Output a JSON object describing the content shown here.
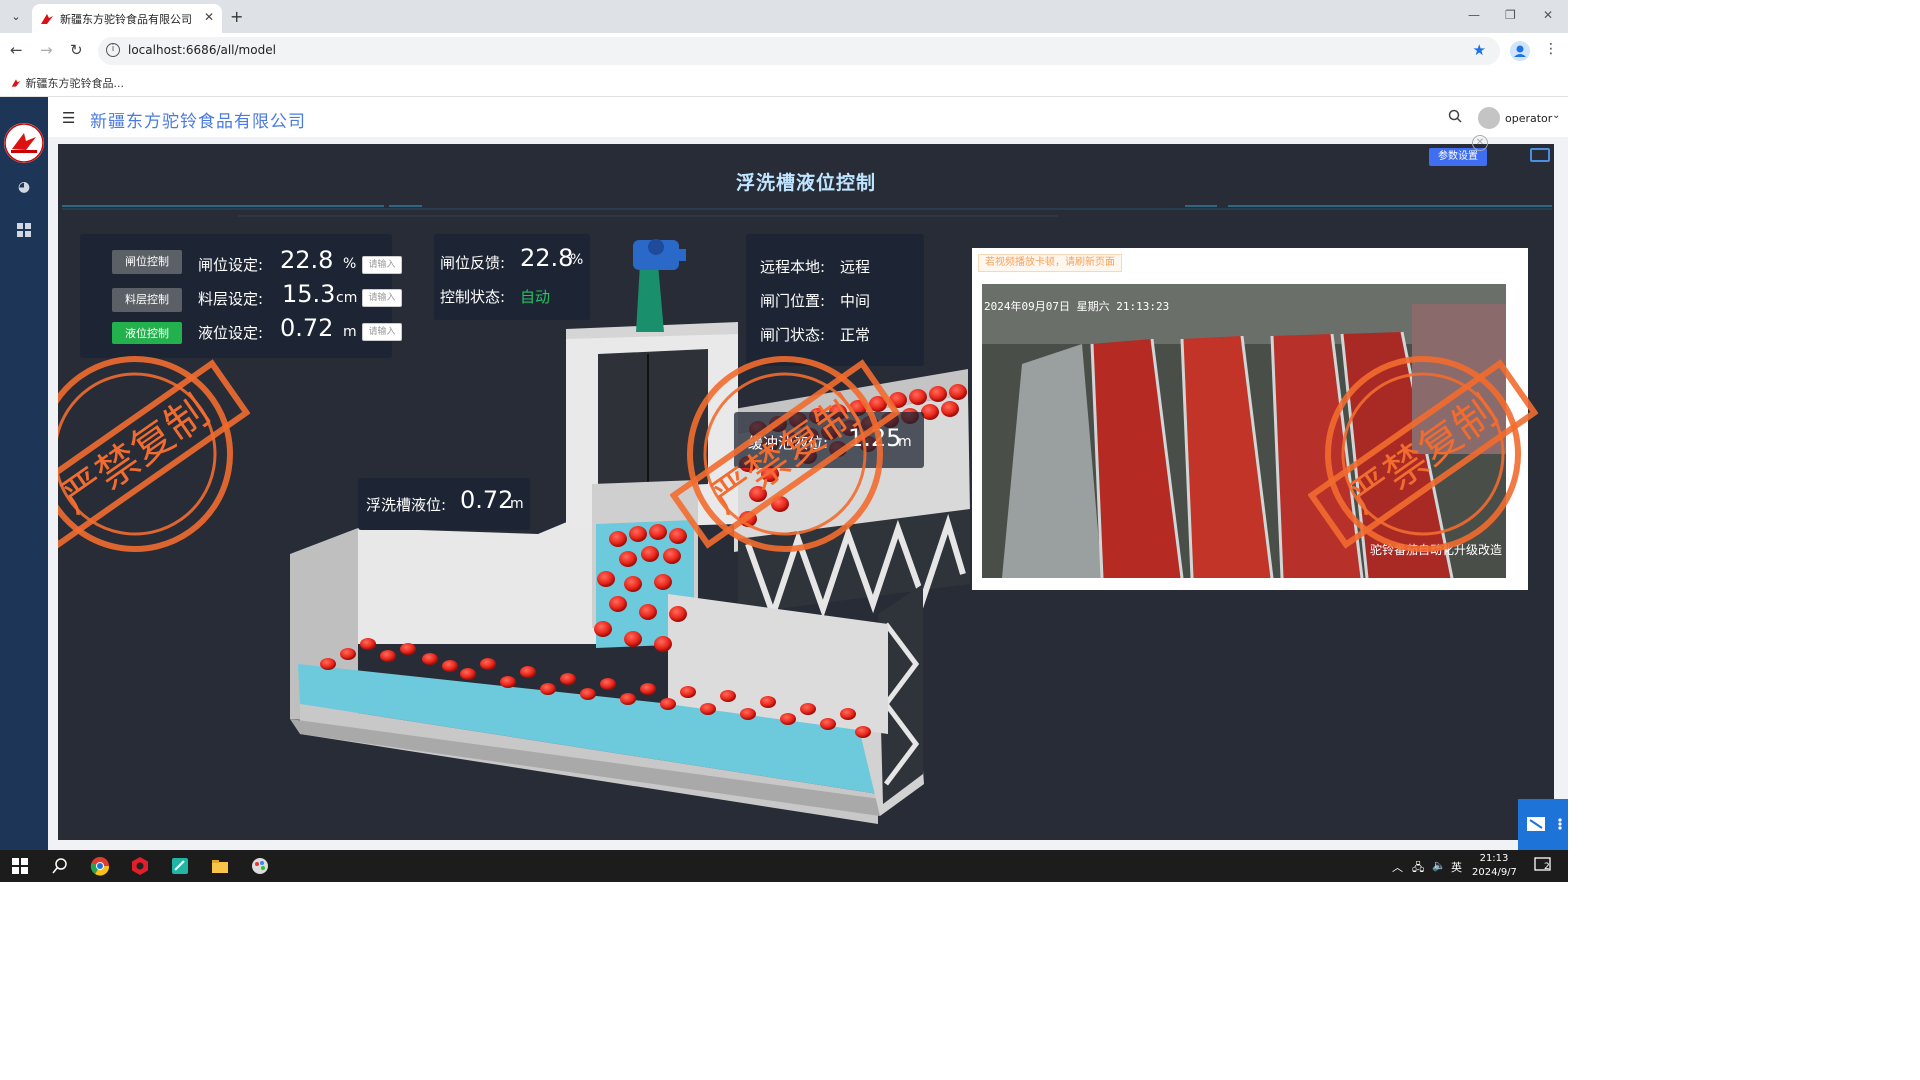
{
  "browser": {
    "tab_title": "新疆东方驼铃食品有限公司",
    "url": "localhost:6686/all/model",
    "bookmark": "新疆东方驼铃食品..."
  },
  "app": {
    "company": "新疆东方驼铃食品有限公司",
    "user": "operator",
    "page_title": "浮洗槽液位控制",
    "param_button": "参数设置"
  },
  "controls": {
    "buttons": [
      "闸位控制",
      "料层控制",
      "液位控制"
    ],
    "rows": [
      {
        "label": "闸位设定:",
        "value": "22.8",
        "unit": "%",
        "placeholder": "请输入"
      },
      {
        "label": "料层设定:",
        "value": "15.3",
        "unit": "cm",
        "placeholder": "请输入"
      },
      {
        "label": "液位设定:",
        "value": "0.72",
        "unit": "m",
        "placeholder": "请输入"
      }
    ]
  },
  "feedback": {
    "gate_label": "闸位反馈:",
    "gate_value": "22.8",
    "gate_unit": "%",
    "state_label": "控制状态:",
    "state_value": "自动"
  },
  "status": {
    "remote_label": "远程本地:",
    "remote_value": "远程",
    "pos_label": "闸门位置:",
    "pos_value": "中间",
    "gate_label": "闸门状态:",
    "gate_value": "正常"
  },
  "levels": {
    "tank_label": "浮洗槽液位:",
    "tank_value": "0.72",
    "tank_unit": "m",
    "buffer_label": "缓冲池液位:",
    "buffer_value": "1.25",
    "buffer_unit": "m"
  },
  "video": {
    "hint": "若视频播放卡顿，请刷新页面",
    "timestamp": "2024年09月07日 星期六 21:13:23",
    "caption": "驼铃番茄自动化升级改造"
  },
  "watermark": "严禁复制",
  "taskbar": {
    "time": "21:13",
    "date": "2024/9/7",
    "ime": "英",
    "notif_count": "2"
  },
  "colors": {
    "accent": "#3f6ff0",
    "active_button": "#22b14c",
    "stamp": "#f26b2f",
    "water": "#5ec5d8",
    "tomato": "#e8261b"
  }
}
